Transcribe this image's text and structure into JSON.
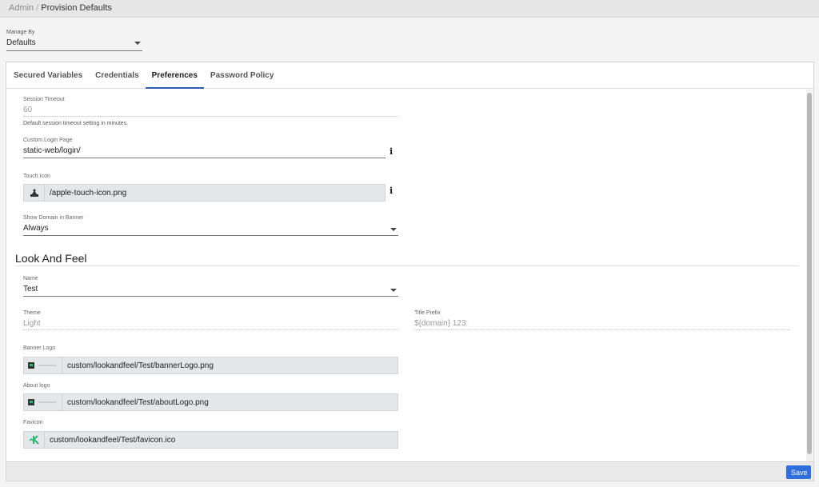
{
  "breadcrumb": {
    "root": "Admin",
    "separator": "/",
    "current": "Provision Defaults"
  },
  "manage_by": {
    "label": "Manage By",
    "value": "Defaults"
  },
  "tabs": [
    {
      "label": "Secured Variables",
      "active": false
    },
    {
      "label": "Credentials",
      "active": false
    },
    {
      "label": "Preferences",
      "active": true
    },
    {
      "label": "Password Policy",
      "active": false
    }
  ],
  "preferences": {
    "session_timeout": {
      "label": "Session Timeout",
      "value": "60",
      "help": "Default session timeout setting in minutes."
    },
    "custom_login_page": {
      "label": "Custom Login Page",
      "value": "static-web/login/",
      "icon": "info-icon"
    },
    "touch_icon": {
      "label": "Touch Icon",
      "value": "/apple-touch-icon.png",
      "icon": "info-icon"
    },
    "show_domain": {
      "label": "Show Domain in Banner",
      "value": "Always"
    }
  },
  "look_and_feel": {
    "title": "Look And Feel",
    "name": {
      "label": "Name",
      "value": "Test"
    },
    "theme": {
      "label": "Theme",
      "value": "Light"
    },
    "title_prefix": {
      "label": "Title Prefix",
      "value": "${domain} 123:"
    },
    "banner_logo": {
      "label": "Banner Logo",
      "value": "custom/lookandfeel/Test/bannerLogo.png"
    },
    "about_logo": {
      "label": "About logo",
      "value": "custom/lookandfeel/Test/aboutLogo.png"
    },
    "favicon": {
      "label": "Favicon",
      "value": "custom/lookandfeel/Test/favicon.ico"
    }
  },
  "footer": {
    "save_label": "Save"
  },
  "colors": {
    "accent": "#2f5bb7",
    "save_button": "#2f6fdd",
    "favicon_green": "#2bb673"
  }
}
